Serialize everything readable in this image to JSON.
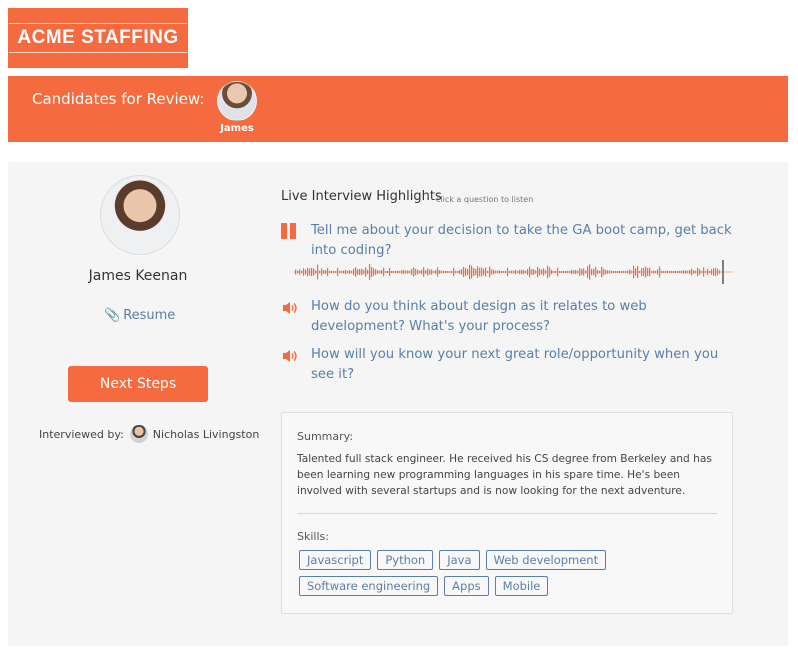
{
  "brand": {
    "logo_text": "ACME STAFFING",
    "accent_color": "#f56a3f",
    "link_color": "#5a7fa8"
  },
  "banner": {
    "title": "Candidates for Review:",
    "candidates": [
      {
        "name": "James",
        "avatar_icon": "candidate-avatar"
      }
    ]
  },
  "profile": {
    "name": "James Keenan",
    "resume_label": "Resume",
    "next_steps_label": "Next Steps",
    "interviewed_by_label": "Interviewed by:",
    "interviewer_name": "Nicholas Livingston"
  },
  "highlights": {
    "title": "Live Interview Highlights",
    "hint": "click a question to listen",
    "questions": [
      {
        "text": "Tell me about your decision to take the GA boot camp, get back into coding?",
        "state": "playing",
        "icon": "pause-icon"
      },
      {
        "text": "How do you think about design as it relates to web development? What's your process?",
        "state": "idle",
        "icon": "speaker-icon"
      },
      {
        "text": "How will you know your next great role/opportunity when you see it?",
        "state": "idle",
        "icon": "speaker-icon"
      }
    ]
  },
  "summary": {
    "label": "Summary:",
    "text": "Talented full stack engineer. He received his CS degree from Berkeley and has been learning new programming languages in his spare time. He's been involved with several startups and is now looking for the next adventure.",
    "skills_label": "Skills:",
    "skills": [
      "Javascript",
      "Python",
      "Java",
      "Web development",
      "Software engineering",
      "Apps",
      "Mobile"
    ]
  }
}
